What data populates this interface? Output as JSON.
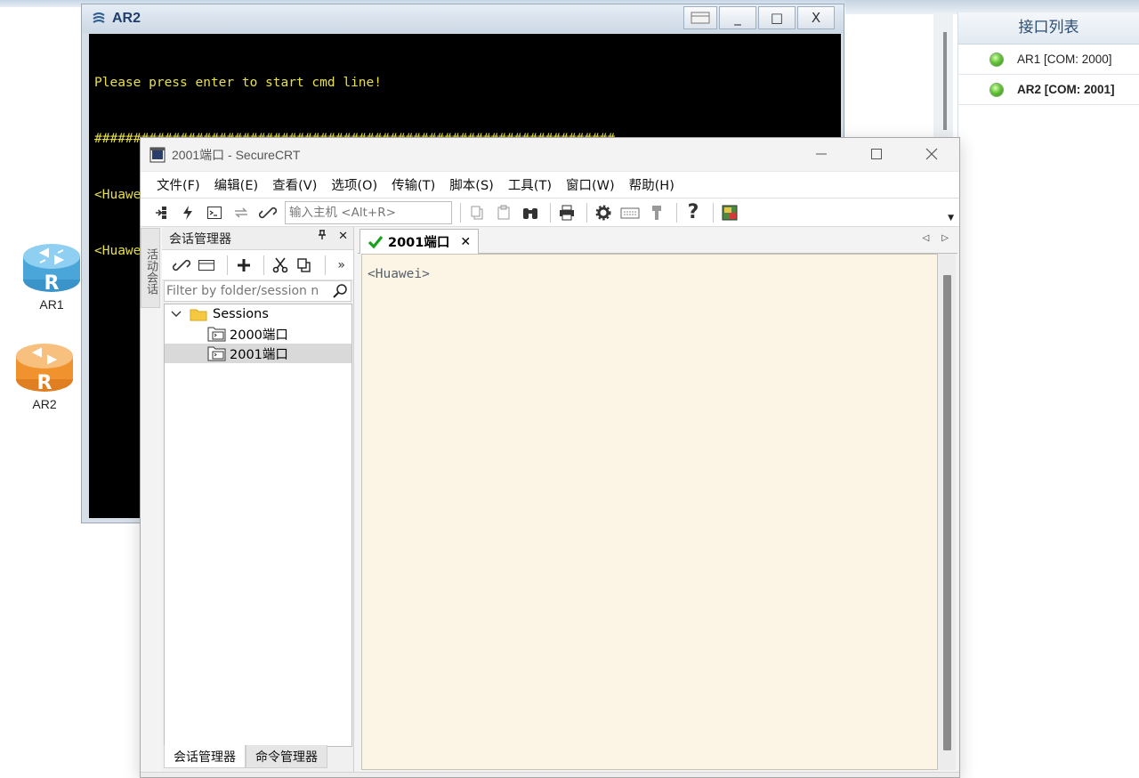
{
  "canvas": {
    "devices": [
      {
        "id": "ar1",
        "label": "AR1",
        "color": "#58b7e8"
      },
      {
        "id": "ar2",
        "label": "AR2",
        "color": "#f39a3c"
      }
    ]
  },
  "interface_panel": {
    "title": "接口列表",
    "items": [
      {
        "label": "AR1 [COM: 2000]",
        "bold": false
      },
      {
        "label": "AR2 [COM: 2001]",
        "bold": true
      }
    ]
  },
  "ar2_window": {
    "title": "AR2",
    "buttons": {
      "minimize": "_",
      "maximize": "□",
      "close": "X"
    },
    "console_lines": [
      "Please press enter to start cmd line!",
      "###################################################################",
      "<Huawei>",
      "<Huawei>"
    ],
    "console_color": "#e8e04a"
  },
  "securecrt": {
    "title": "2001端口 - SecureCRT",
    "menu": [
      "文件(F)",
      "编辑(E)",
      "查看(V)",
      "选项(O)",
      "传输(T)",
      "脚本(S)",
      "工具(T)",
      "窗口(W)",
      "帮助(H)"
    ],
    "toolbar": {
      "host_placeholder": "输入主机 <Alt+R>",
      "icons": [
        "connect-bar-icon",
        "lightning-icon",
        "terminal-icon",
        "reconnect-icon",
        "link-icon",
        "copy-icon",
        "paste-icon",
        "find-icon",
        "print-icon",
        "settings-icon",
        "keymap-icon",
        "key-icon",
        "help-icon",
        "sftp-icon"
      ]
    },
    "vertical_tab": "活动会话",
    "session_manager": {
      "title": "会话管理器",
      "pin": "ᵖ",
      "close": "✕",
      "more": "»",
      "filter_placeholder": "Filter by folder/session n",
      "tree": {
        "root": "Sessions",
        "children": [
          {
            "label": "2000端口",
            "selected": false
          },
          {
            "label": "2001端口",
            "selected": true
          }
        ]
      },
      "bottom_tabs": [
        "会话管理器",
        "命令管理器"
      ]
    },
    "tab": {
      "label": "2001端口",
      "status_color": "#1aa01a"
    },
    "terminal": {
      "lines": [
        "<Huawei>"
      ],
      "background": "#fcf5e5"
    }
  }
}
